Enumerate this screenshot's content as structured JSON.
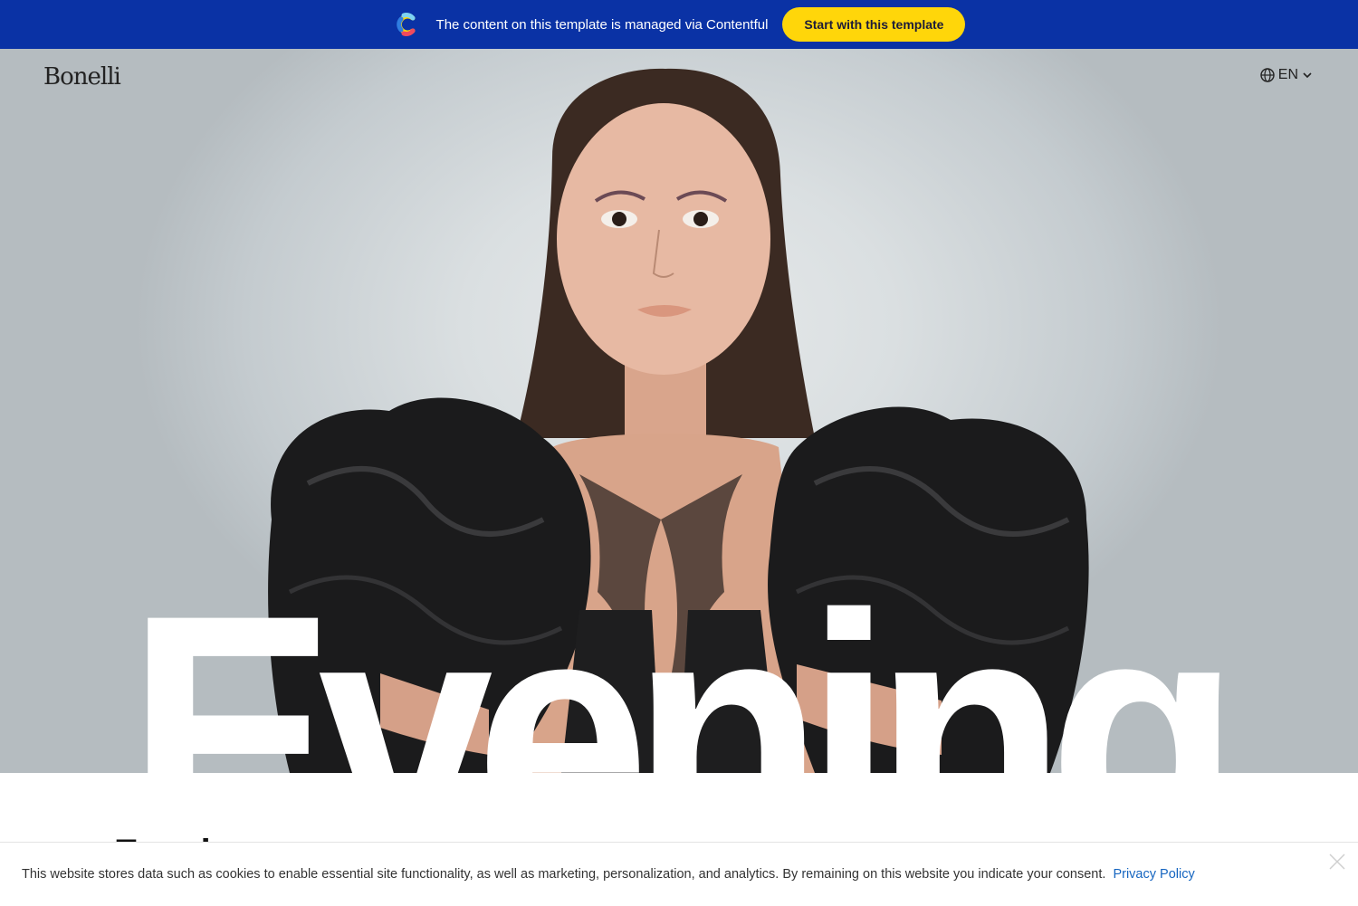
{
  "topbar": {
    "message": "The content on this template is managed via Contentful",
    "cta_label": "Start with this template",
    "background": "#0a32a5",
    "cta_color": "#ffd60a"
  },
  "header": {
    "brand": "Bonelli",
    "language": "EN",
    "language_icon": "globe-icon"
  },
  "hero": {
    "headline": "Evening",
    "image_alt": "Model wearing black leather puff-sleeve dress"
  },
  "main": {
    "section_title": "Evening"
  },
  "cookie_banner": {
    "message": "This website stores data such as cookies to enable essential site functionality, as well as marketing, personalization, and analytics. By remaining on this website you indicate your consent.",
    "link_label": "Privacy Policy"
  }
}
